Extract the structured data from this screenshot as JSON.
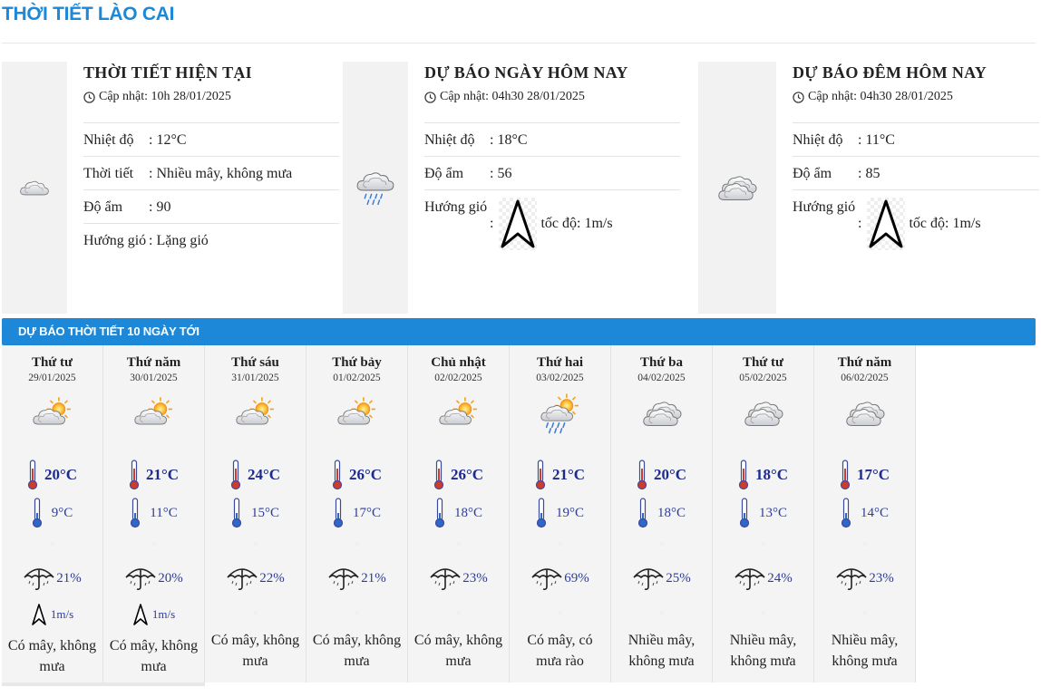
{
  "page_title": "THỜI TIẾT LÀO CAI",
  "current": {
    "title": "THỜI TIẾT HIỆN TẠI",
    "updated": "Cập nhật: 10h 28/01/2025",
    "icon": "partly-cloudy-icon",
    "rows": [
      {
        "label": "Nhiệt độ",
        "value": ": 12°C"
      },
      {
        "label": "Thời tiết",
        "value": ": Nhiều mây, không mưa"
      },
      {
        "label": "Độ ẩm",
        "value": ": 90"
      },
      {
        "label": "Hướng gió",
        "value": ": Lặng gió"
      }
    ]
  },
  "today": {
    "title": "DỰ BÁO NGÀY HÔM NAY",
    "updated": "Cập nhật: 04h30 28/01/2025",
    "icon": "rain-cloud-icon",
    "rows": [
      {
        "label": "Nhiệt độ",
        "value": ": 18°C"
      },
      {
        "label": "Độ ẩm",
        "value": ": 56"
      },
      {
        "label": "Hướng gió",
        "value": ":",
        "speed": "tốc độ: 1m/s"
      }
    ]
  },
  "tonight": {
    "title": "DỰ BÁO ĐÊM HÔM NAY",
    "updated": "Cập nhật: 04h30 28/01/2025",
    "icon": "cloudy-icon",
    "rows": [
      {
        "label": "Nhiệt độ",
        "value": ": 11°C"
      },
      {
        "label": "Độ ẩm",
        "value": ": 85"
      },
      {
        "label": "Hướng gió",
        "value": ":",
        "speed": "tốc độ: 1m/s"
      }
    ]
  },
  "forecast_title": "DỰ BÁO THỜI TIẾT 10 NGÀY TỚI",
  "days": [
    {
      "name": "Thứ tư",
      "date": "29/01/2025",
      "icon": "sun-cloud-icon",
      "max": "20°C",
      "min": "9°C",
      "rain": "21%",
      "wind": "1m/s",
      "desc": "Có mây, không mưa"
    },
    {
      "name": "Thứ năm",
      "date": "30/01/2025",
      "icon": "sun-cloud-icon",
      "max": "21°C",
      "min": "11°C",
      "rain": "20%",
      "wind": "1m/s",
      "desc": "Có mây, không mưa"
    },
    {
      "name": "Thứ sáu",
      "date": "31/01/2025",
      "icon": "sun-cloud-icon",
      "max": "24°C",
      "min": "15°C",
      "rain": "22%",
      "wind": "",
      "desc": "Có mây, không mưa"
    },
    {
      "name": "Thứ bảy",
      "date": "01/02/2025",
      "icon": "sun-cloud-icon",
      "max": "26°C",
      "min": "17°C",
      "rain": "21%",
      "wind": "",
      "desc": "Có mây, không mưa"
    },
    {
      "name": "Chủ nhật",
      "date": "02/02/2025",
      "icon": "sun-cloud-icon",
      "max": "26°C",
      "min": "18°C",
      "rain": "23%",
      "wind": "",
      "desc": "Có mây, không mưa"
    },
    {
      "name": "Thứ hai",
      "date": "03/02/2025",
      "icon": "sun-rain-cloud-icon",
      "max": "21°C",
      "min": "19°C",
      "rain": "69%",
      "wind": "",
      "desc": "Có mây, có mưa rào"
    },
    {
      "name": "Thứ ba",
      "date": "04/02/2025",
      "icon": "cloudy-icon",
      "max": "20°C",
      "min": "18°C",
      "rain": "25%",
      "wind": "",
      "desc": "Nhiều mây, không mưa"
    },
    {
      "name": "Thứ tư",
      "date": "05/02/2025",
      "icon": "cloudy-icon",
      "max": "18°C",
      "min": "13°C",
      "rain": "24%",
      "wind": "",
      "desc": "Nhiều mây, không mưa"
    },
    {
      "name": "Thứ năm",
      "date": "06/02/2025",
      "icon": "cloudy-icon",
      "max": "17°C",
      "min": "14°C",
      "rain": "23%",
      "wind": "",
      "desc": "Nhiều mây, không mưa"
    }
  ],
  "colors": {
    "accent": "#1e88d8",
    "temp": "#1d2a8c",
    "panel": "#f4f4f4"
  }
}
